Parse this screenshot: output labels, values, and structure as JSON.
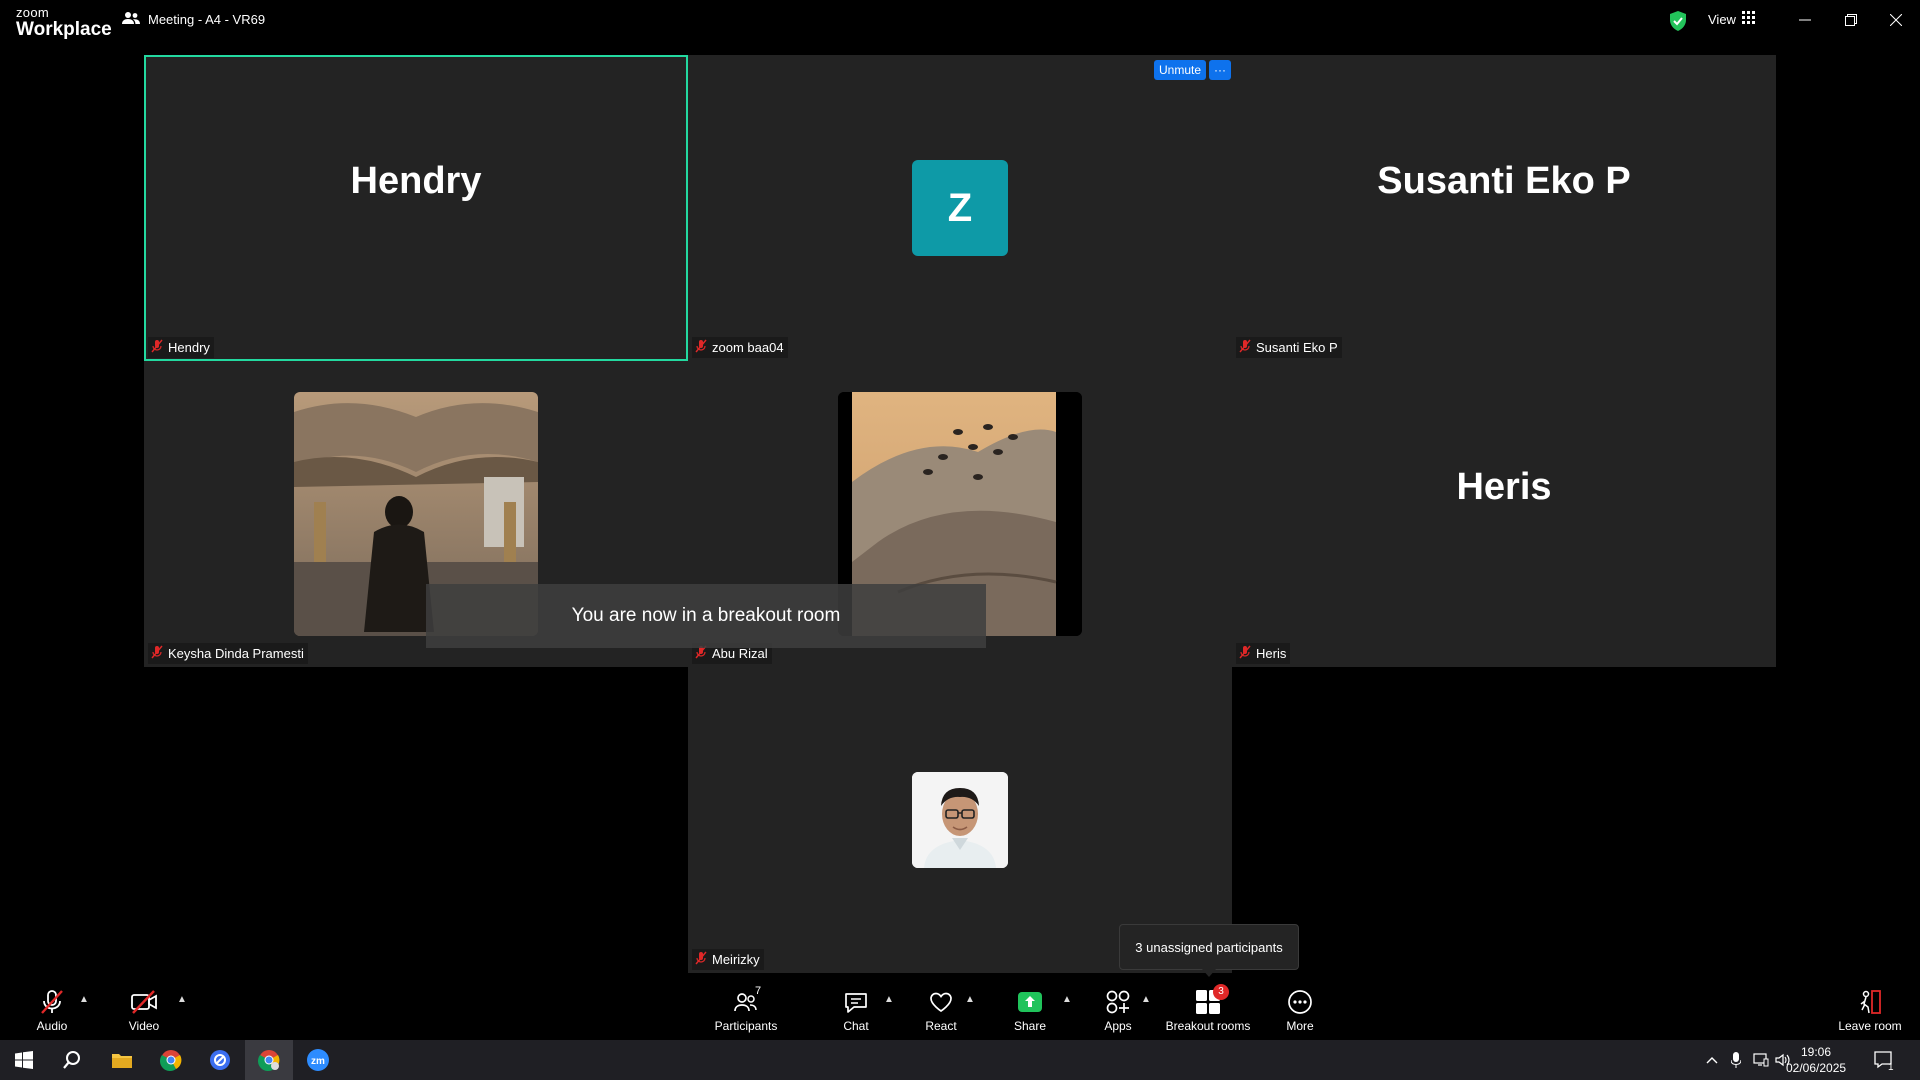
{
  "app": {
    "logo_line1": "zoom",
    "logo_line2": "Workplace",
    "meeting_title": "Meeting - A4 - VR69",
    "view_label": "View"
  },
  "participants": [
    {
      "tile_name": "Hendry",
      "label": "Hendry",
      "display": "name",
      "active": true
    },
    {
      "tile_name": "Z",
      "label": "zoom baa04",
      "display": "letter-avatar",
      "avatar_color": "#0e9aa7"
    },
    {
      "tile_name": "Susanti Eko P",
      "label": "Susanti Eko P",
      "display": "name"
    },
    {
      "tile_name": "",
      "label": "Keysha Dinda Pramesti",
      "display": "photo"
    },
    {
      "tile_name": "",
      "label": "Abu Rizal",
      "display": "photo"
    },
    {
      "tile_name": "Heris",
      "label": "Heris",
      "display": "name"
    },
    {
      "tile_name": "",
      "label": "Meirizky",
      "display": "avatar-photo"
    }
  ],
  "unmute_button": {
    "label": "Unmute",
    "more_label": "···"
  },
  "toast": "You are now in a breakout room",
  "tooltip": "3 unassigned participants",
  "controls": {
    "audio": "Audio",
    "video": "Video",
    "participants": "Participants",
    "participants_count": "7",
    "chat": "Chat",
    "react": "React",
    "share": "Share",
    "apps": "Apps",
    "breakout_rooms": "Breakout rooms",
    "breakout_badge": "3",
    "more": "More",
    "leave_room": "Leave room"
  },
  "taskbar": {
    "time": "19:06",
    "date": "02/06/2025",
    "notification_count": "1"
  },
  "colors": {
    "active_border": "#23d9a0",
    "accent_blue": "#0e72ed",
    "mute_red": "#e02828",
    "share_green": "#20c35b"
  }
}
